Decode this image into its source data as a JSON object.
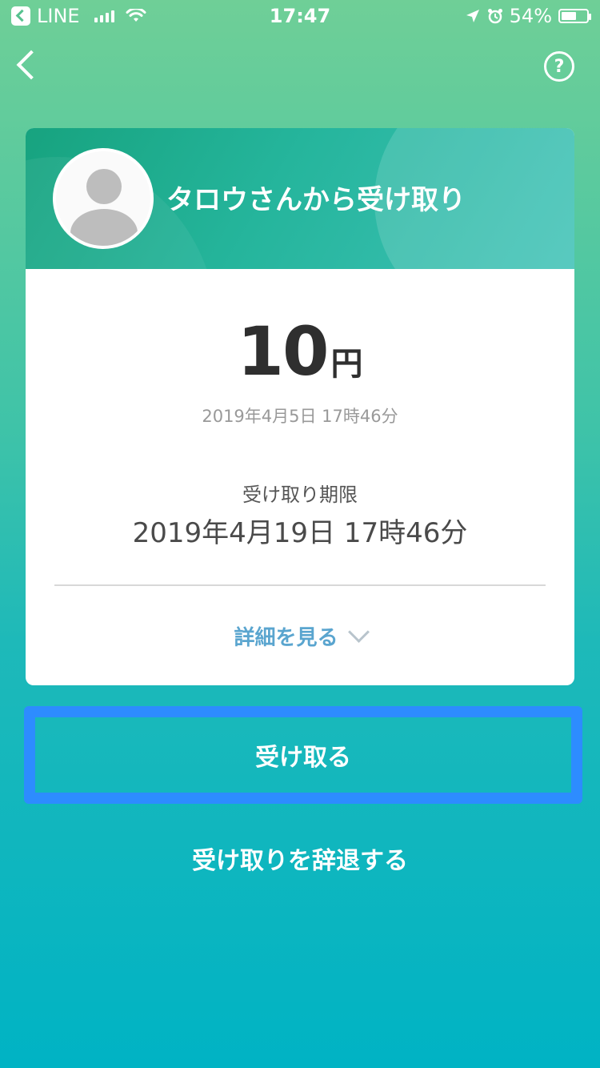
{
  "status_bar": {
    "app_name": "LINE",
    "time": "17:47",
    "battery_percent": "54%"
  },
  "header": {
    "help_label": "?"
  },
  "card": {
    "title": "タロウさんから受け取り",
    "amount": "10",
    "currency_unit": "円",
    "sent_date": "2019年4月5日 17時46分",
    "deadline_label": "受け取り期限",
    "deadline_value": "2019年4月19日 17時46分",
    "details_label": "詳細を見る"
  },
  "actions": {
    "receive_label": "受け取る",
    "decline_label": "受け取りを辞退する"
  },
  "colors": {
    "bg_top": "#6fcf97",
    "bg_bottom": "#00b3c4",
    "card_header": "#25b59c",
    "highlight_border": "#2d8cff",
    "link": "#5aa5cf"
  },
  "icons": {
    "back": "chevron-left-icon",
    "help": "question-circle-icon",
    "avatar": "user-avatar-icon",
    "details": "chevron-down-icon"
  }
}
